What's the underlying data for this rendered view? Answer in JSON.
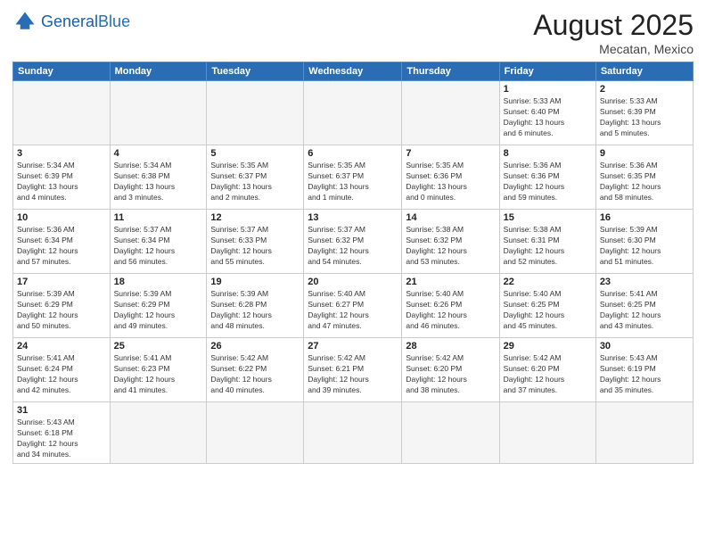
{
  "header": {
    "logo_general": "General",
    "logo_blue": "Blue",
    "month_year": "August 2025",
    "location": "Mecatan, Mexico"
  },
  "days_of_week": [
    "Sunday",
    "Monday",
    "Tuesday",
    "Wednesday",
    "Thursday",
    "Friday",
    "Saturday"
  ],
  "weeks": [
    [
      {
        "day": "",
        "info": ""
      },
      {
        "day": "",
        "info": ""
      },
      {
        "day": "",
        "info": ""
      },
      {
        "day": "",
        "info": ""
      },
      {
        "day": "",
        "info": ""
      },
      {
        "day": "1",
        "info": "Sunrise: 5:33 AM\nSunset: 6:40 PM\nDaylight: 13 hours\nand 6 minutes."
      },
      {
        "day": "2",
        "info": "Sunrise: 5:33 AM\nSunset: 6:39 PM\nDaylight: 13 hours\nand 5 minutes."
      }
    ],
    [
      {
        "day": "3",
        "info": "Sunrise: 5:34 AM\nSunset: 6:39 PM\nDaylight: 13 hours\nand 4 minutes."
      },
      {
        "day": "4",
        "info": "Sunrise: 5:34 AM\nSunset: 6:38 PM\nDaylight: 13 hours\nand 3 minutes."
      },
      {
        "day": "5",
        "info": "Sunrise: 5:35 AM\nSunset: 6:37 PM\nDaylight: 13 hours\nand 2 minutes."
      },
      {
        "day": "6",
        "info": "Sunrise: 5:35 AM\nSunset: 6:37 PM\nDaylight: 13 hours\nand 1 minute."
      },
      {
        "day": "7",
        "info": "Sunrise: 5:35 AM\nSunset: 6:36 PM\nDaylight: 13 hours\nand 0 minutes."
      },
      {
        "day": "8",
        "info": "Sunrise: 5:36 AM\nSunset: 6:36 PM\nDaylight: 12 hours\nand 59 minutes."
      },
      {
        "day": "9",
        "info": "Sunrise: 5:36 AM\nSunset: 6:35 PM\nDaylight: 12 hours\nand 58 minutes."
      }
    ],
    [
      {
        "day": "10",
        "info": "Sunrise: 5:36 AM\nSunset: 6:34 PM\nDaylight: 12 hours\nand 57 minutes."
      },
      {
        "day": "11",
        "info": "Sunrise: 5:37 AM\nSunset: 6:34 PM\nDaylight: 12 hours\nand 56 minutes."
      },
      {
        "day": "12",
        "info": "Sunrise: 5:37 AM\nSunset: 6:33 PM\nDaylight: 12 hours\nand 55 minutes."
      },
      {
        "day": "13",
        "info": "Sunrise: 5:37 AM\nSunset: 6:32 PM\nDaylight: 12 hours\nand 54 minutes."
      },
      {
        "day": "14",
        "info": "Sunrise: 5:38 AM\nSunset: 6:32 PM\nDaylight: 12 hours\nand 53 minutes."
      },
      {
        "day": "15",
        "info": "Sunrise: 5:38 AM\nSunset: 6:31 PM\nDaylight: 12 hours\nand 52 minutes."
      },
      {
        "day": "16",
        "info": "Sunrise: 5:39 AM\nSunset: 6:30 PM\nDaylight: 12 hours\nand 51 minutes."
      }
    ],
    [
      {
        "day": "17",
        "info": "Sunrise: 5:39 AM\nSunset: 6:29 PM\nDaylight: 12 hours\nand 50 minutes."
      },
      {
        "day": "18",
        "info": "Sunrise: 5:39 AM\nSunset: 6:29 PM\nDaylight: 12 hours\nand 49 minutes."
      },
      {
        "day": "19",
        "info": "Sunrise: 5:39 AM\nSunset: 6:28 PM\nDaylight: 12 hours\nand 48 minutes."
      },
      {
        "day": "20",
        "info": "Sunrise: 5:40 AM\nSunset: 6:27 PM\nDaylight: 12 hours\nand 47 minutes."
      },
      {
        "day": "21",
        "info": "Sunrise: 5:40 AM\nSunset: 6:26 PM\nDaylight: 12 hours\nand 46 minutes."
      },
      {
        "day": "22",
        "info": "Sunrise: 5:40 AM\nSunset: 6:25 PM\nDaylight: 12 hours\nand 45 minutes."
      },
      {
        "day": "23",
        "info": "Sunrise: 5:41 AM\nSunset: 6:25 PM\nDaylight: 12 hours\nand 43 minutes."
      }
    ],
    [
      {
        "day": "24",
        "info": "Sunrise: 5:41 AM\nSunset: 6:24 PM\nDaylight: 12 hours\nand 42 minutes."
      },
      {
        "day": "25",
        "info": "Sunrise: 5:41 AM\nSunset: 6:23 PM\nDaylight: 12 hours\nand 41 minutes."
      },
      {
        "day": "26",
        "info": "Sunrise: 5:42 AM\nSunset: 6:22 PM\nDaylight: 12 hours\nand 40 minutes."
      },
      {
        "day": "27",
        "info": "Sunrise: 5:42 AM\nSunset: 6:21 PM\nDaylight: 12 hours\nand 39 minutes."
      },
      {
        "day": "28",
        "info": "Sunrise: 5:42 AM\nSunset: 6:20 PM\nDaylight: 12 hours\nand 38 minutes."
      },
      {
        "day": "29",
        "info": "Sunrise: 5:42 AM\nSunset: 6:20 PM\nDaylight: 12 hours\nand 37 minutes."
      },
      {
        "day": "30",
        "info": "Sunrise: 5:43 AM\nSunset: 6:19 PM\nDaylight: 12 hours\nand 35 minutes."
      }
    ],
    [
      {
        "day": "31",
        "info": "Sunrise: 5:43 AM\nSunset: 6:18 PM\nDaylight: 12 hours\nand 34 minutes."
      },
      {
        "day": "",
        "info": ""
      },
      {
        "day": "",
        "info": ""
      },
      {
        "day": "",
        "info": ""
      },
      {
        "day": "",
        "info": ""
      },
      {
        "day": "",
        "info": ""
      },
      {
        "day": "",
        "info": ""
      }
    ]
  ]
}
